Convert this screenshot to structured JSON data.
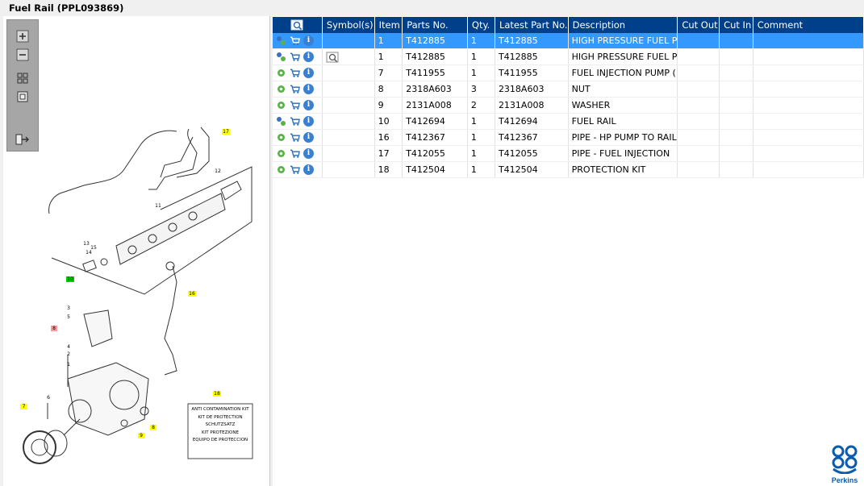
{
  "window": {
    "title": "Fuel Rail (PPL093869)"
  },
  "toolbar": {
    "zoom_in": "zoom-in-icon",
    "zoom_out": "zoom-out-icon",
    "fit_all": "fit-all-icon",
    "fit_window": "fit-window-icon",
    "export": "export-icon"
  },
  "grid": {
    "headers": [
      "",
      "Symbol(s)",
      "Item",
      "Parts No.",
      "Qty.",
      "Latest Part No.",
      "Description",
      "Cut Out",
      "Cut In",
      "Comment"
    ],
    "rows": [
      {
        "item": "1",
        "part": "T412885",
        "qty": "1",
        "latest": "T412885",
        "desc": "HIGH PRESSURE FUEL P",
        "selected": true,
        "symbol": ""
      },
      {
        "item": "1",
        "part": "T412885",
        "qty": "1",
        "latest": "T412885",
        "desc": "HIGH PRESSURE FUEL P",
        "selected": false,
        "symbol": "view"
      },
      {
        "item": "7",
        "part": "T411955",
        "qty": "1",
        "latest": "T411955",
        "desc": "FUEL INJECTION PUMP (",
        "selected": false,
        "symbol": ""
      },
      {
        "item": "8",
        "part": "2318A603",
        "qty": "3",
        "latest": "2318A603",
        "desc": "NUT",
        "selected": false,
        "symbol": ""
      },
      {
        "item": "9",
        "part": "2131A008",
        "qty": "2",
        "latest": "2131A008",
        "desc": "WASHER",
        "selected": false,
        "symbol": ""
      },
      {
        "item": "10",
        "part": "T412694",
        "qty": "1",
        "latest": "T412694",
        "desc": "FUEL RAIL",
        "selected": false,
        "symbol": ""
      },
      {
        "item": "16",
        "part": "T412367",
        "qty": "1",
        "latest": "T412367",
        "desc": "PIPE - HP PUMP TO RAIL",
        "selected": false,
        "symbol": ""
      },
      {
        "item": "17",
        "part": "T412055",
        "qty": "1",
        "latest": "T412055",
        "desc": "PIPE - FUEL INJECTION",
        "selected": false,
        "symbol": ""
      },
      {
        "item": "18",
        "part": "T412504",
        "qty": "1",
        "latest": "T412504",
        "desc": "PROTECTION KIT",
        "selected": false,
        "symbol": ""
      }
    ]
  },
  "diagram": {
    "callouts": {
      "c17": "17",
      "c12": "12",
      "c11": "11",
      "c13": "13",
      "c15": "15",
      "c14": "14",
      "c10": "10",
      "c16": "16",
      "c3": "3",
      "c5": "5",
      "c8": "8",
      "c4": "4",
      "c2": "2",
      "c1": "1",
      "c6": "6",
      "c7": "7",
      "c9": "9",
      "c18": "18"
    },
    "kit_label": [
      "ANTI CONTAMINATION KIT",
      "KIT DE PROTECTION",
      "SCHUTZSATZ",
      "KIT PROTEZIONE",
      "EQUIPO DE PROTECCION"
    ]
  },
  "brand": {
    "name": "Perkins",
    "color": "#0a5cae"
  },
  "colors": {
    "header": "#003f8a",
    "selection": "#3399ff"
  }
}
